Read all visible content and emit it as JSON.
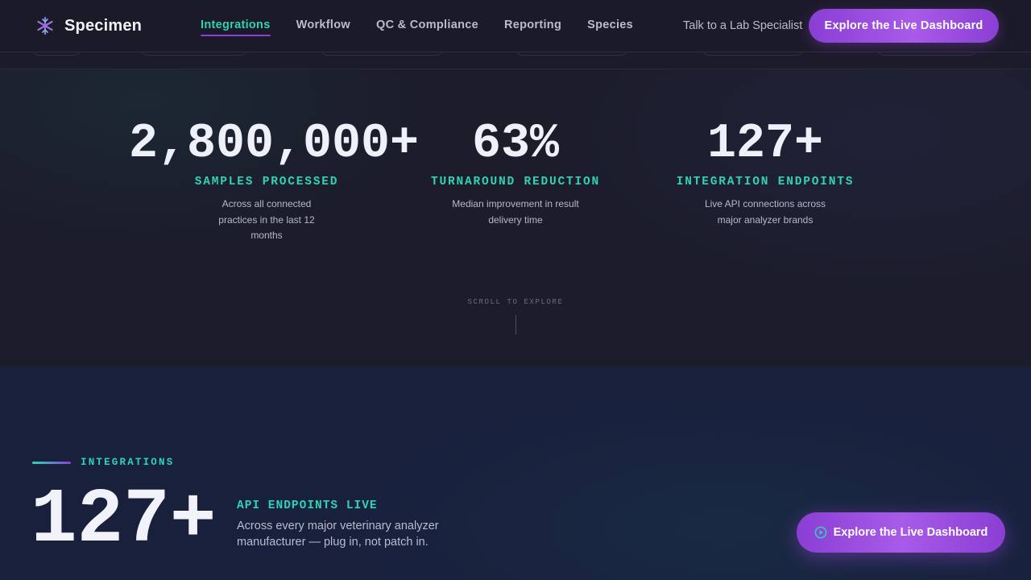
{
  "brand": {
    "name": "Specimen",
    "logo_icon": "snowflake-asterisk-icon"
  },
  "nav": {
    "items": [
      {
        "label": "Integrations",
        "active": true
      },
      {
        "label": "Workflow",
        "active": false
      },
      {
        "label": "QC & Compliance",
        "active": false
      },
      {
        "label": "Reporting",
        "active": false
      },
      {
        "label": "Species",
        "active": false
      }
    ],
    "talk_link": "Talk to a Lab Specialist",
    "cta": "Explore the Live Dashboard"
  },
  "stats": [
    {
      "value": "2,800,000+",
      "label": "SAMPLES PROCESSED",
      "desc": "Across all connected practices in the last 12 months"
    },
    {
      "value": "63%",
      "label": "TURNAROUND REDUCTION",
      "desc": "Median improvement in result delivery time"
    },
    {
      "value": "127+",
      "label": "INTEGRATION ENDPOINTS",
      "desc": "Live API connections across major analyzer brands"
    }
  ],
  "scroll_hint": "SCROLL TO EXPLORE",
  "integrations": {
    "eyebrow": "INTEGRATIONS",
    "big_number": "127+",
    "api_title": "API ENDPOINTS LIVE",
    "api_desc": "Across every major veterinary analyzer manufacturer — plug in, not patch in."
  },
  "floating_cta": {
    "label": "Explore the Live Dashboard",
    "icon": "play-circle-icon"
  },
  "colors": {
    "accent_teal": "#2fd3b4",
    "accent_purple": "#8b3fd6",
    "bg_dark": "#1c1b2a",
    "bg_navy": "#18203c"
  }
}
